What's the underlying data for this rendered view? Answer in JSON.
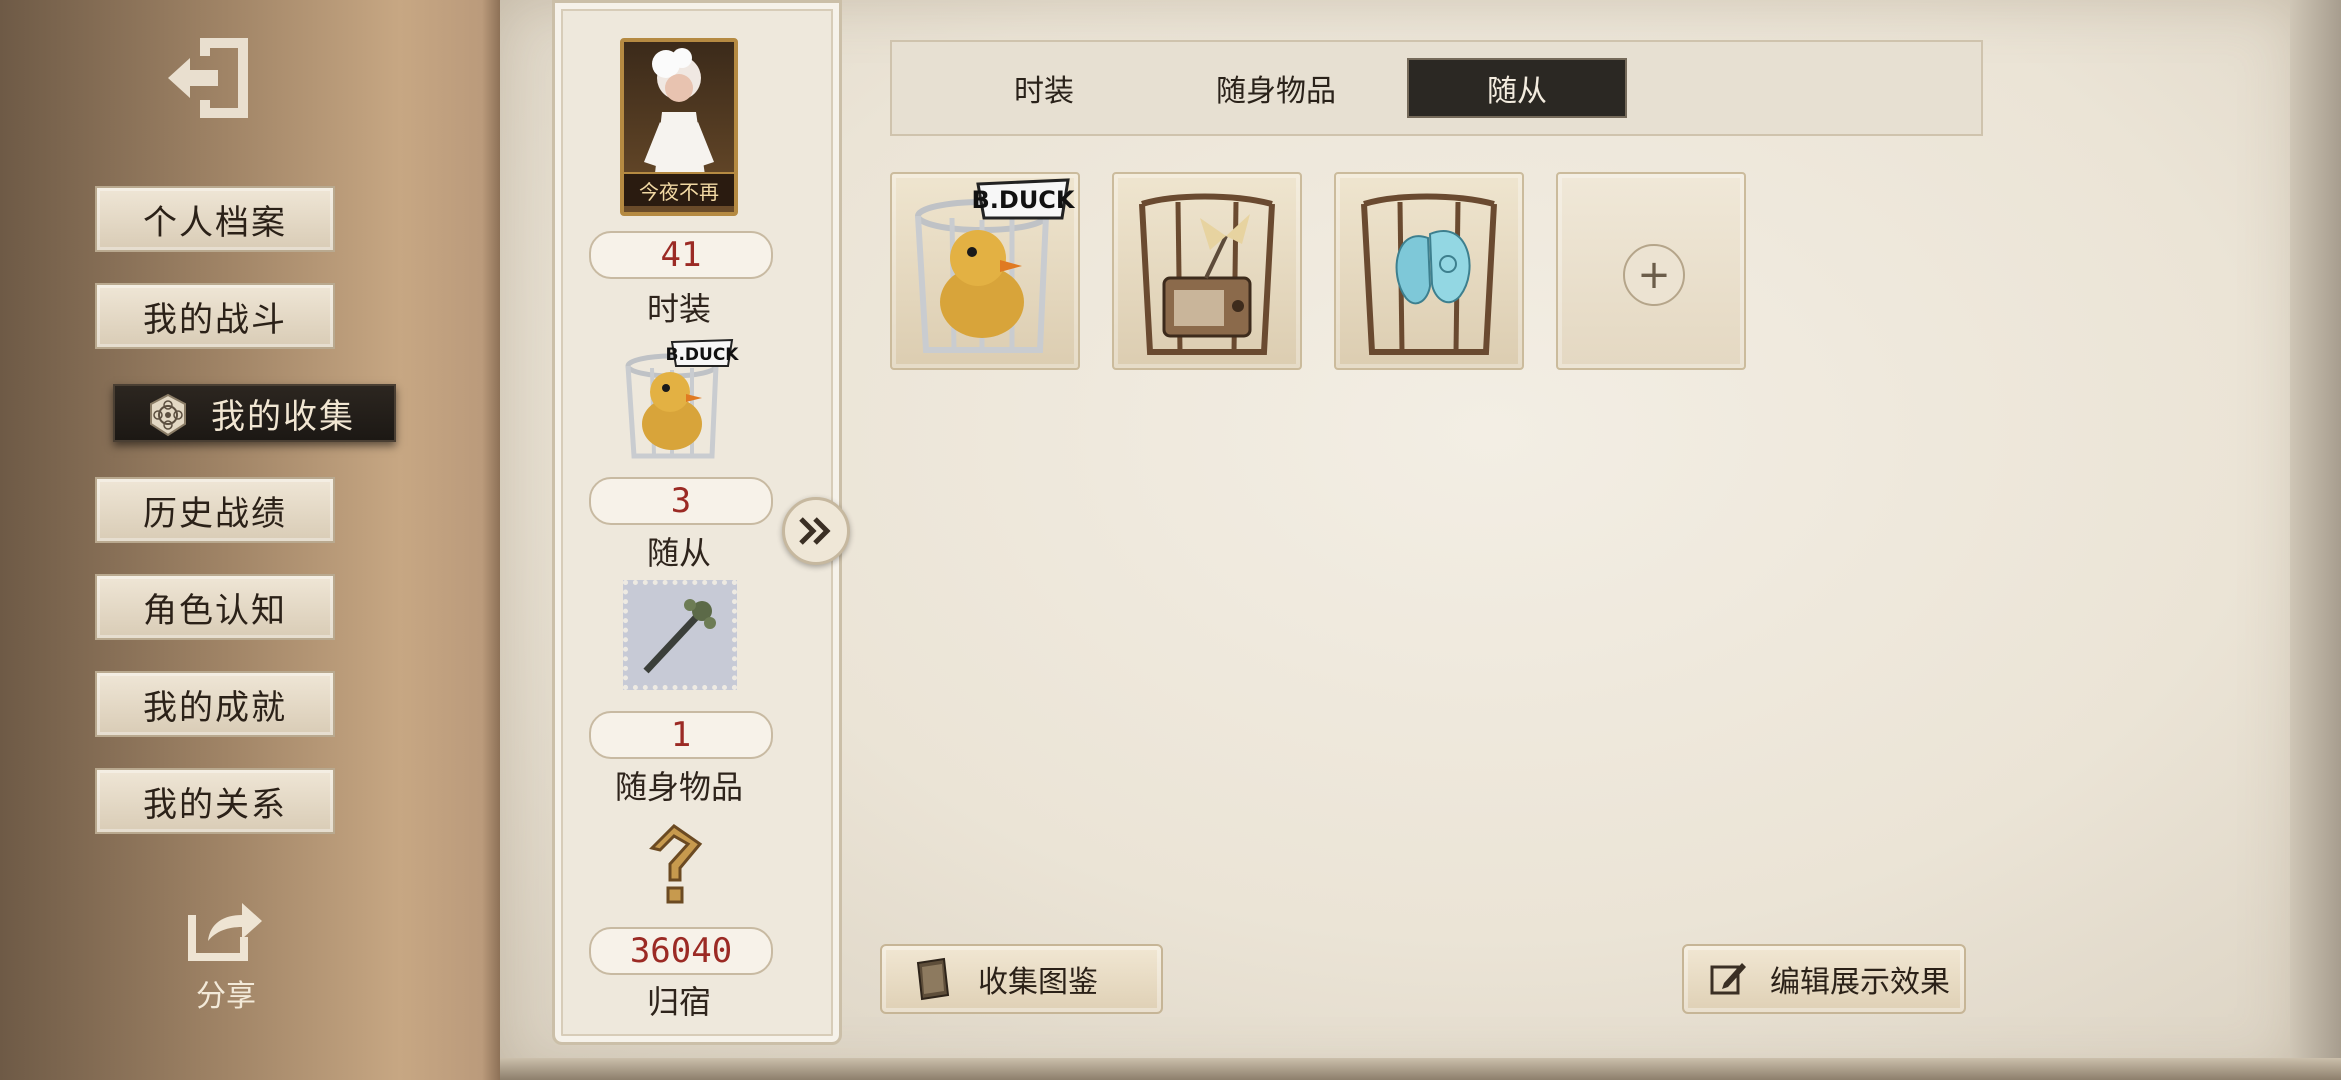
{
  "sidebar": {
    "items": [
      {
        "label": "个人档案"
      },
      {
        "label": "我的战斗"
      },
      {
        "label": "我的收集",
        "active": true
      },
      {
        "label": "历史战绩"
      },
      {
        "label": "角色认知"
      },
      {
        "label": "我的成就"
      },
      {
        "label": "我的关系"
      }
    ],
    "share_label": "分享"
  },
  "summary": {
    "portrait_caption": "今夜不再",
    "fashion_count": "41",
    "fashion_label": "时装",
    "pet_count": "3",
    "pet_label": "随从",
    "item_count": "1",
    "item_label": "随身物品",
    "home_count": "36040",
    "home_label": "归宿",
    "pet_caption": "B.DUCK"
  },
  "tabs": [
    {
      "label": "时装"
    },
    {
      "label": "随身物品"
    },
    {
      "label": "随从",
      "active": true
    }
  ],
  "slots": [
    {
      "icon": "bduck-pet-icon",
      "caption": "B.DUCK"
    },
    {
      "icon": "radio-fan-pet-icon"
    },
    {
      "icon": "butterfly-pet-icon"
    },
    {
      "icon": "add-slot-icon",
      "empty": true
    }
  ],
  "buttons": {
    "collection_catalog": "收集图鉴",
    "edit_display": "编辑展示效果"
  },
  "colors": {
    "accent_red": "#9b2a24",
    "active_dark": "#2b2823"
  }
}
